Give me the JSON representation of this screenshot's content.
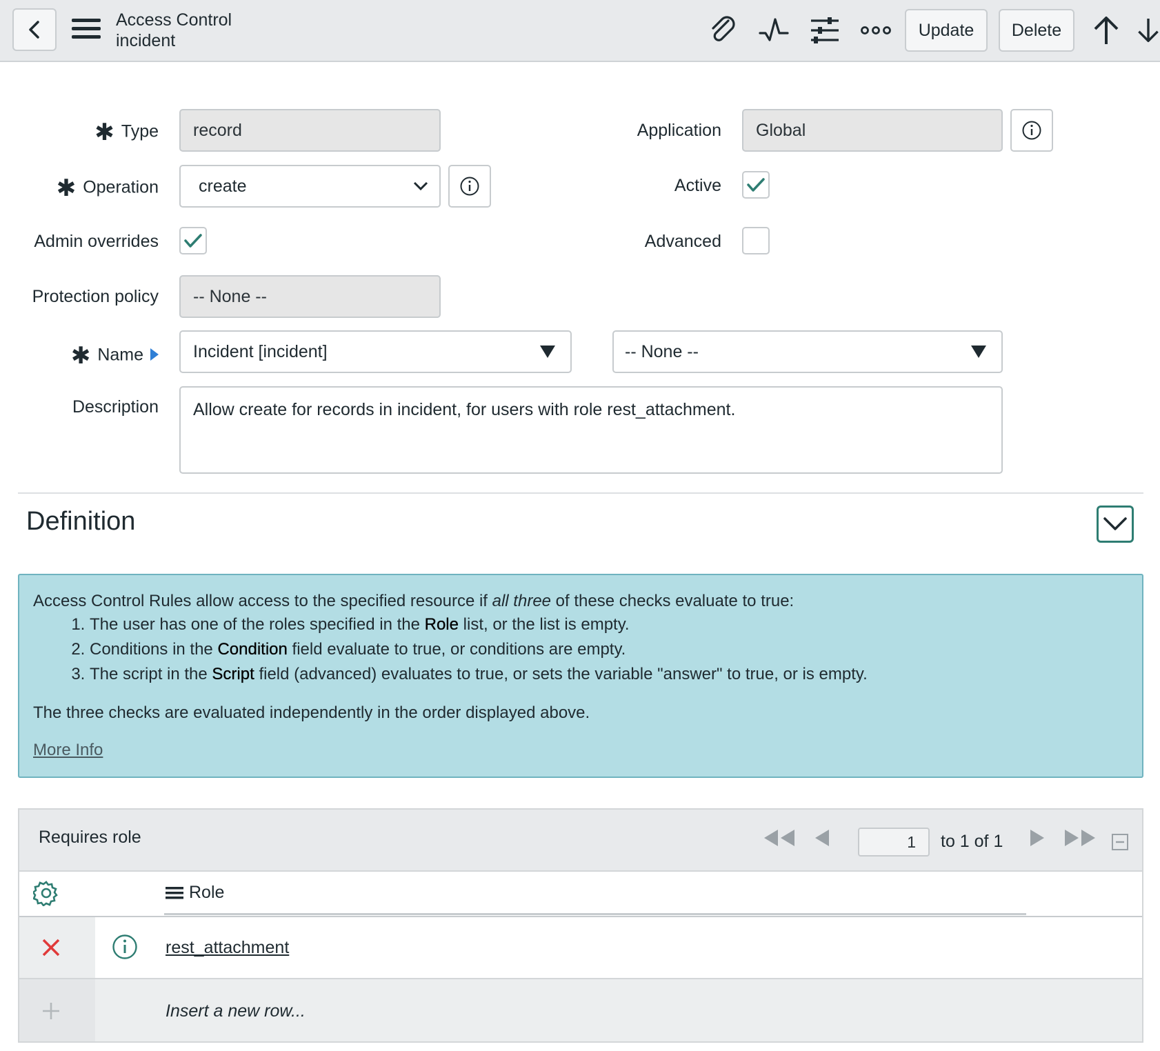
{
  "header": {
    "title_line1": "Access Control",
    "title_line2": "incident",
    "update_label": "Update",
    "delete_label": "Delete"
  },
  "form": {
    "type_label": "Type",
    "type_value": "record",
    "operation_label": "Operation",
    "operation_value": "create",
    "admin_overrides_label": "Admin overrides",
    "admin_overrides_checked": true,
    "protection_label": "Protection policy",
    "protection_value": "-- None --",
    "name_label": "Name",
    "name_value": "Incident [incident]",
    "name_field_value": "-- None --",
    "description_label": "Description",
    "description_value": "Allow create for records in incident, for users with role rest_attachment.",
    "application_label": "Application",
    "application_value": "Global",
    "active_label": "Active",
    "active_checked": true,
    "advanced_label": "Advanced",
    "advanced_checked": false
  },
  "definition": {
    "title": "Definition",
    "intro_before": "Access Control Rules allow access to the specified resource if ",
    "intro_em": "all three",
    "intro_after": " of these checks evaluate to true:",
    "items": [
      {
        "before": "The user has one of the roles specified in the ",
        "strong": "Role",
        "after": " list, or the list is empty."
      },
      {
        "before": "Conditions in the ",
        "strong": "Condition",
        "after": " field evaluate to true, or conditions are empty."
      },
      {
        "before": "The script in the ",
        "strong": "Script",
        "after": " field (advanced) evaluates to true, or sets the variable \"answer\" to true, or is empty."
      }
    ],
    "note": "The three checks are evaluated independently in the order displayed above.",
    "more_info": "More Info"
  },
  "related_list": {
    "title": "Requires role",
    "page_value": "1",
    "page_text": "to 1 of 1",
    "column_role": "Role",
    "rows": [
      {
        "role": "rest_attachment"
      }
    ],
    "insert_placeholder": "Insert a new row..."
  },
  "colors": {
    "accent": "#2e7d72",
    "info_bg": "#b3dde4",
    "delete_x": "#e03a3a",
    "header_bg": "#e8eaec"
  }
}
